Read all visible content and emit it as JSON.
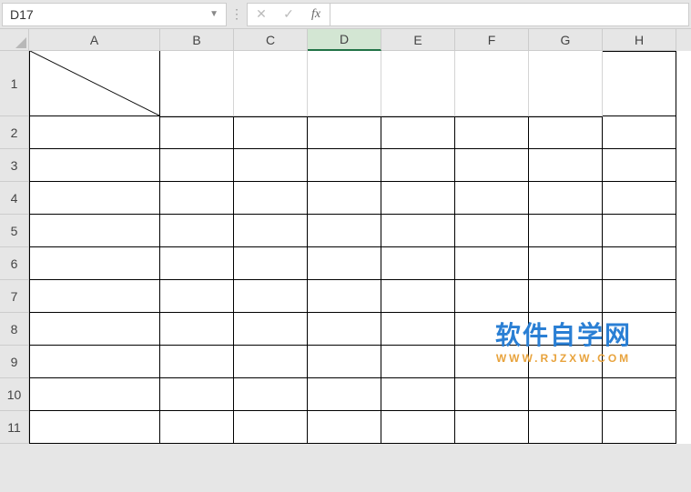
{
  "namebox": {
    "value": "D17"
  },
  "formula_bar": {
    "cancel_icon": "✕",
    "enter_icon": "✓",
    "fx_label": "fx",
    "value": ""
  },
  "columns": [
    "A",
    "B",
    "C",
    "D",
    "E",
    "F",
    "G",
    "H"
  ],
  "selected_column": "D",
  "rows": [
    "1",
    "2",
    "3",
    "4",
    "5",
    "6",
    "7",
    "8",
    "9",
    "10",
    "11"
  ],
  "watermark": {
    "title": "软件自学网",
    "url": "WWW.RJZXW.COM"
  }
}
